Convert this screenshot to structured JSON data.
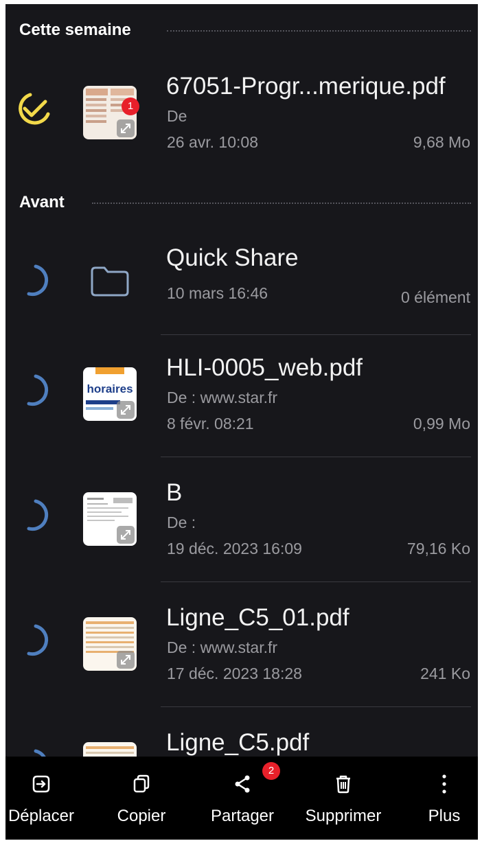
{
  "sections": {
    "this_week": "Cette semaine",
    "before": "Avant"
  },
  "files": [
    {
      "name": "67051-Progr...merique.pdf",
      "source": "De",
      "date": "26 avr. 10:08",
      "size": "9,68 Mo",
      "selected": true
    },
    {
      "name": "Quick Share",
      "source": "",
      "date": "10 mars 16:46",
      "size": "0 élément",
      "selected": false,
      "type": "folder"
    },
    {
      "name": "HLI-0005_web.pdf",
      "source": "De : www.star.fr",
      "date": "8 févr. 08:21",
      "size": "0,99 Mo",
      "selected": false,
      "thumb_text": "horaires"
    },
    {
      "name": "B",
      "source": "De :",
      "date": "19 déc. 2023 16:09",
      "size": "79,16 Ko",
      "selected": false
    },
    {
      "name": "Ligne_C5_01.pdf",
      "source": "De : www.star.fr",
      "date": "17 déc. 2023 18:28",
      "size": "241 Ko",
      "selected": false
    },
    {
      "name": "Ligne_C5.pdf",
      "source": "",
      "date": "",
      "size": "",
      "selected": false
    }
  ],
  "badges": {
    "file_badge": "1",
    "share_badge": "2"
  },
  "actions": {
    "move": "Déplacer",
    "copy": "Copier",
    "share": "Partager",
    "delete": "Supprimer",
    "more": "Plus"
  },
  "colors": {
    "background": "#17171b",
    "bottom_bar": "#000000",
    "selected_check": "#f2d94a",
    "unselected_check": "#4f7fbf",
    "badge": "#e8202a",
    "folder_icon": "#8fa7c6"
  }
}
